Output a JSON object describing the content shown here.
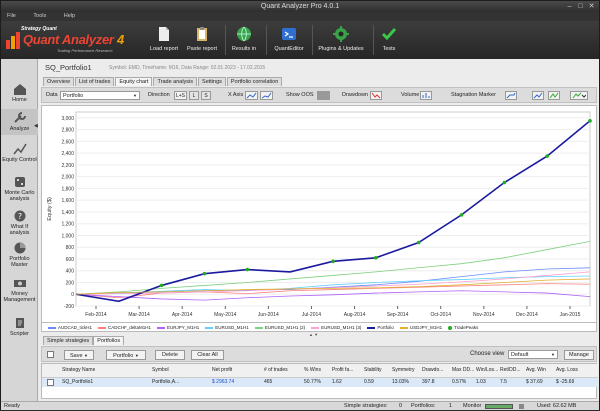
{
  "window": {
    "title": "Quant Analyzer Pro 4.0.1"
  },
  "menu": [
    "File",
    "Tools",
    "Help"
  ],
  "logo": {
    "top": "Strategy Quant",
    "name": "Quant Analyzer",
    "version": "4",
    "tagline": "Trading Performance Research"
  },
  "toolbar": [
    {
      "label": "Load report",
      "icon": "document-icon"
    },
    {
      "label": "Paste report",
      "icon": "clipboard-icon"
    },
    {
      "label": "Results in",
      "icon": "globe-icon"
    },
    {
      "label": "QuantEditor",
      "icon": "editor-icon"
    },
    {
      "label": "Plugins & Updates",
      "icon": "gear-icon"
    },
    {
      "label": "Tests",
      "icon": "check-icon"
    }
  ],
  "sidebar": [
    {
      "label": "Home",
      "icon": "home-icon"
    },
    {
      "label": "Analyze",
      "icon": "wrench-icon"
    },
    {
      "label": "Equity Control",
      "icon": "equity-icon"
    },
    {
      "label": "Monte Carlo analysis",
      "icon": "dice-icon"
    },
    {
      "label": "What If analysis",
      "icon": "question-icon"
    },
    {
      "label": "Portfolio Master",
      "icon": "pie-icon"
    },
    {
      "label": "Money Management",
      "icon": "money-icon"
    },
    {
      "label": "Scripter",
      "icon": "script-icon"
    }
  ],
  "page": {
    "title": "SQ_Portfolio1",
    "meta": "Symbol: EMD, Timeframe: M16, Data Range: 02.01.2023 - 17.02.2015"
  },
  "tabs": [
    "Overview",
    "List of trades",
    "Equity chart",
    "Trade analysis",
    "Settings",
    "Portfolio correlation"
  ],
  "options": {
    "data_label": "Data",
    "data_value": "Portfolio",
    "direction_label": "Direction",
    "dir_both": "L+S",
    "dir_long": "L",
    "dir_short": "S",
    "xaxis_label": "X Axis",
    "showoos_label": "Show OOS",
    "drawdown_label": "Drawdown",
    "volume_label": "Volume",
    "stagnation_label": "Stagnation Marker"
  },
  "chart_data": {
    "type": "line",
    "ylabel": "Equity ($)",
    "ylim": [
      -200,
      3100
    ],
    "yticks": [
      "3,000",
      "2,800",
      "2,600",
      "2,400",
      "2,200",
      "2,000",
      "1,800",
      "1,600",
      "1,400",
      "1,200",
      "1,000",
      "800",
      "600",
      "400",
      "200",
      "0",
      "-200"
    ],
    "xticks": [
      "Feb-2014",
      "Mar-2014",
      "Apr-2014",
      "May-2014",
      "Jun-2014",
      "Jul-2014",
      "Aug-2014",
      "Sep-2014",
      "Oct-2014",
      "Nov-2014",
      "Dec-2014",
      "Jan-2015"
    ],
    "series": [
      {
        "name": "AUDCAD_tickH1",
        "color": "#6a8cff",
        "values": [
          0,
          20,
          40,
          60,
          70,
          80,
          120,
          160,
          220,
          300,
          380,
          430,
          450
        ]
      },
      {
        "name": "CADCHF_deltaM1H1",
        "color": "#ff7f7f",
        "values": [
          0,
          -60,
          20,
          40,
          10,
          60,
          80,
          100,
          120,
          140,
          160,
          180,
          170
        ]
      },
      {
        "name": "EURJPY_M1H1",
        "color": "#b060ff",
        "values": [
          0,
          -40,
          -80,
          -100,
          -60,
          -30,
          -10,
          20,
          40,
          60,
          40,
          20,
          -40
        ]
      },
      {
        "name": "EURUSD_M1H1",
        "color": "#60d0ff",
        "values": [
          0,
          20,
          50,
          80,
          60,
          100,
          160,
          200,
          230,
          250,
          280,
          300,
          310
        ]
      },
      {
        "name": "EURUSD_M1H1 (2)",
        "color": "#7fd07f",
        "values": [
          0,
          40,
          100,
          150,
          200,
          260,
          320,
          380,
          450,
          520,
          620,
          760,
          900
        ]
      },
      {
        "name": "EURUSD_M1H1 (3)",
        "color": "#ffa0d0",
        "values": [
          0,
          10,
          20,
          40,
          60,
          90,
          110,
          140,
          170,
          210,
          260,
          320,
          380
        ]
      },
      {
        "name": "Portfolio",
        "color": "#1a1aa0",
        "values": [
          0,
          -120,
          150,
          350,
          420,
          380,
          560,
          620,
          880,
          1350,
          1900,
          2350,
          2950
        ]
      },
      {
        "name": "USDJPY_M1H1",
        "color": "#e0b030",
        "values": [
          0,
          30,
          40,
          60,
          80,
          90,
          100,
          110,
          130,
          160,
          200,
          240,
          260
        ]
      }
    ],
    "trade_peaks_label": "TradePeaks",
    "legend_position": "bottom"
  },
  "bottom": {
    "tabs": [
      "Simple strategies",
      "Portfolios"
    ],
    "buttons": [
      "Save",
      "Portfolio",
      "Delete",
      "Clear All"
    ],
    "chooseview_label": "Choose view",
    "chooseview_value": "Default",
    "manage": "Manage"
  },
  "table": {
    "headers": [
      "Strategy Name",
      "Symbol",
      "Net profit",
      "# of trades",
      "% Wins",
      "Profit fa...",
      "Stability",
      "Symmetry",
      "Drawdo...",
      "Max DD...",
      "Win/Los...",
      "Ret/DD...",
      "Avg. Win",
      "Avg. Loss"
    ],
    "rows": [
      [
        "SQ_Portfolio1",
        "Portfolio,A...",
        "$ 2963.74",
        "465",
        "50.77%",
        "1.62",
        "0.59",
        "13.03%",
        "397.8",
        "0.57%",
        "1.03",
        "7.5",
        "$ 37.69",
        "$ -25.69"
      ]
    ]
  },
  "status": {
    "ready": "Ready",
    "simple_label": "Simple strategies:",
    "simple_count": "0",
    "portfolios_label": "Portfolios:",
    "portfolios_count": "1",
    "monitor": "Monitor",
    "memory": "Used: 62.62 MB"
  }
}
